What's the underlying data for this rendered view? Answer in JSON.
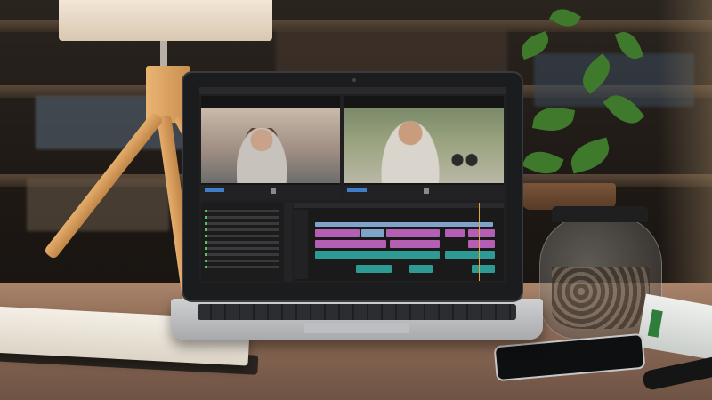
{
  "scene": {
    "description_free": true,
    "colors": {
      "desk": "#8c6a55",
      "clip_video": "#b45fb4",
      "clip_audio": "#2e9a94",
      "timecode_blue": "#3e7ec8",
      "playhead": "#e2a83d",
      "plant_green": "#3f7a2c"
    }
  },
  "editor": {
    "icons": [
      "play-icon",
      "timeline-tool-icon"
    ]
  }
}
